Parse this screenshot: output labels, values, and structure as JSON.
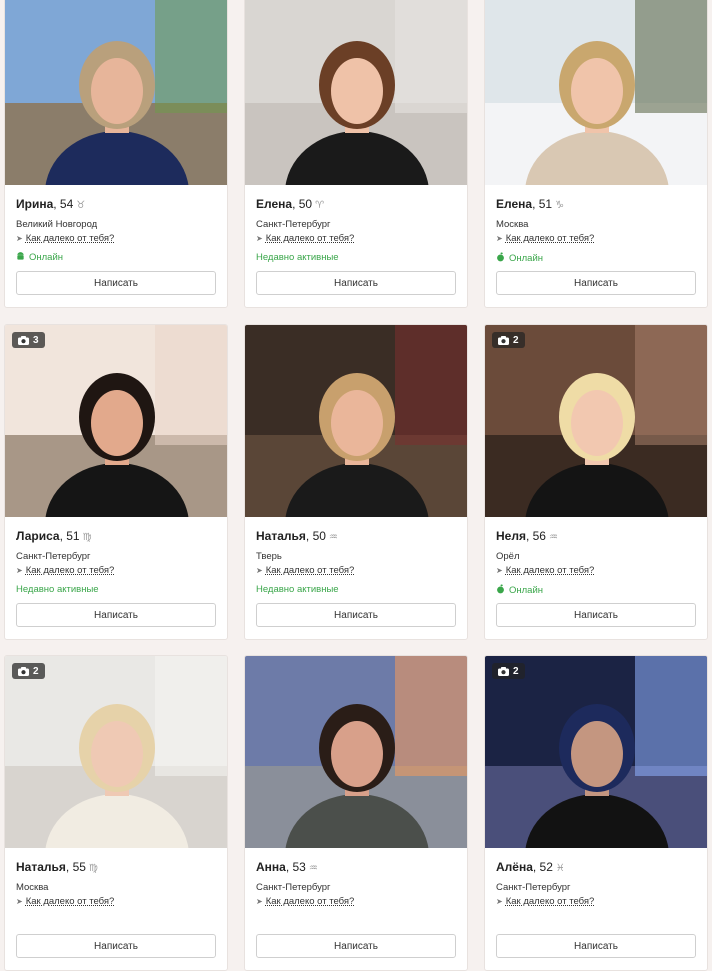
{
  "write_button_label": "Написать",
  "distance_label": "Как далеко от тебя?",
  "profiles": [
    {
      "name": "Ирина",
      "age": ", 54",
      "zodiac": "♉",
      "city": "Великий Новгород",
      "status": "Онлайн",
      "status_device": "android",
      "photos": ""
    },
    {
      "name": "Елена",
      "age": ", 50",
      "zodiac": "♈",
      "city": "Санкт-Петербург",
      "status": "Недавно активные",
      "status_device": "",
      "photos": ""
    },
    {
      "name": "Елена",
      "age": ", 51",
      "zodiac": "♑",
      "city": "Москва",
      "status": "Онлайн",
      "status_device": "apple",
      "photos": ""
    },
    {
      "name": "Лариса",
      "age": ", 51",
      "zodiac": "♍",
      "city": "Санкт-Петербург",
      "status": "Недавно активные",
      "status_device": "",
      "photos": "3"
    },
    {
      "name": "Наталья",
      "age": ", 50",
      "zodiac": "♒",
      "city": "Тверь",
      "status": "Недавно активные",
      "status_device": "",
      "photos": ""
    },
    {
      "name": "Неля",
      "age": ", 56",
      "zodiac": "♒",
      "city": "Орёл",
      "status": "Онлайн",
      "status_device": "apple",
      "photos": "2"
    },
    {
      "name": "Наталья",
      "age": ", 55",
      "zodiac": "♍",
      "city": "Москва",
      "status": "",
      "status_device": "",
      "photos": "2"
    },
    {
      "name": "Анна",
      "age": ", 53",
      "zodiac": "♒",
      "city": "Санкт-Петербург",
      "status": "",
      "status_device": "",
      "photos": ""
    },
    {
      "name": "Алёна",
      "age": ", 52",
      "zodiac": "♓",
      "city": "Санкт-Петербург",
      "status": "",
      "status_device": "",
      "photos": "2"
    }
  ],
  "colors": {
    "online": "#3aa64a",
    "page_bg": "#f6f1ef"
  }
}
